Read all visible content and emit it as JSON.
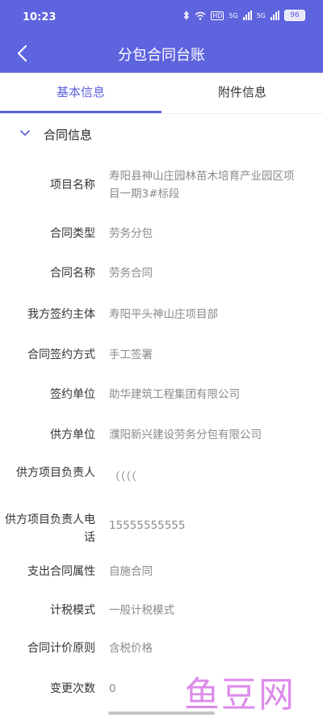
{
  "status": {
    "time": "10:23",
    "net1": "5G",
    "net2": "5G",
    "battery": "96"
  },
  "nav": {
    "title": "分包合同台账"
  },
  "tabs": [
    {
      "label": "基本信息",
      "active": true
    },
    {
      "label": "附件信息",
      "active": false
    }
  ],
  "section": {
    "title": "合同信息"
  },
  "fields": [
    {
      "label": "项目名称",
      "value": "寿阳县神山庄园林苗木培育产业园区项目一期3#标段"
    },
    {
      "label": "合同类型",
      "value": "劳务分包"
    },
    {
      "label": "合同名称",
      "value": "劳务合同"
    },
    {
      "label": "我方签约主体",
      "value": "寿阳平头神山庄项目部"
    },
    {
      "label": "合同签约方式",
      "value": "手工签署"
    },
    {
      "label": "签约单位",
      "value": "助华建筑工程集团有限公司"
    },
    {
      "label": "供方单位",
      "value": "濮阳新兴建设劳务分包有限公司"
    },
    {
      "label": "供方项目负责人",
      "value": "（（（（"
    },
    {
      "label": "供方项目负责人电话",
      "value": "15555555555"
    },
    {
      "label": "支出合同属性",
      "value": "自施合同"
    },
    {
      "label": "计税模式",
      "value": "一般计税模式"
    },
    {
      "label": "合同计价原则",
      "value": "含税价格"
    },
    {
      "label": "变更次数",
      "value": "0"
    }
  ],
  "watermark": "鱼豆网",
  "colors": {
    "primary": "#5e63de",
    "watermark": "#d879e8"
  }
}
